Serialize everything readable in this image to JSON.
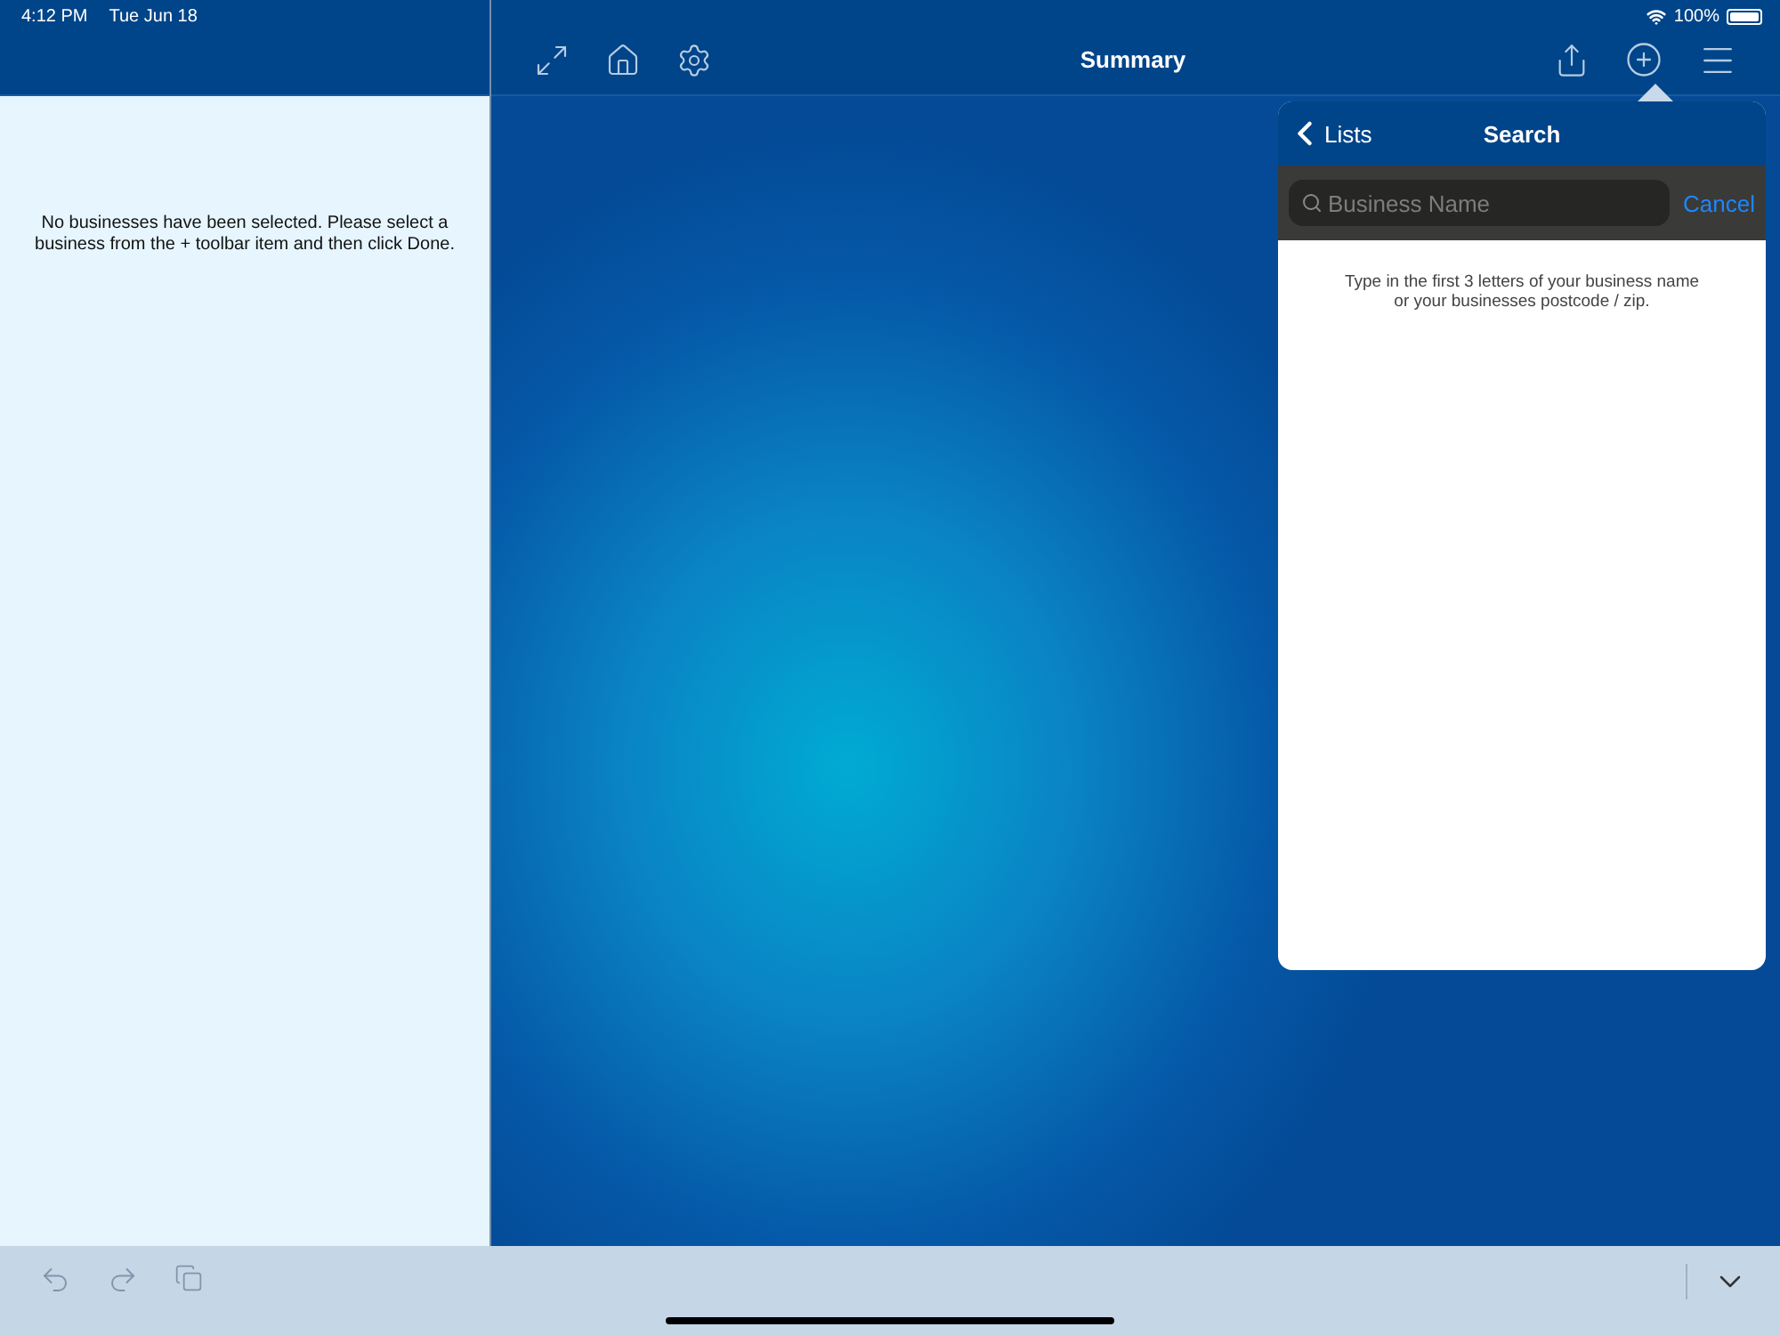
{
  "status_bar": {
    "time": "4:12 PM",
    "date": "Tue Jun 18",
    "battery": "100%"
  },
  "toolbar": {
    "title": "Summary"
  },
  "sidebar": {
    "message": "No businesses have been selected. Please select a business from the + toolbar item and then click Done."
  },
  "popover": {
    "back": "Lists",
    "title": "Search",
    "search": {
      "placeholder": "Business Name"
    },
    "cancel": "Cancel",
    "hint": "Type in the first 3 letters of your business name or your businesses postcode / zip."
  }
}
